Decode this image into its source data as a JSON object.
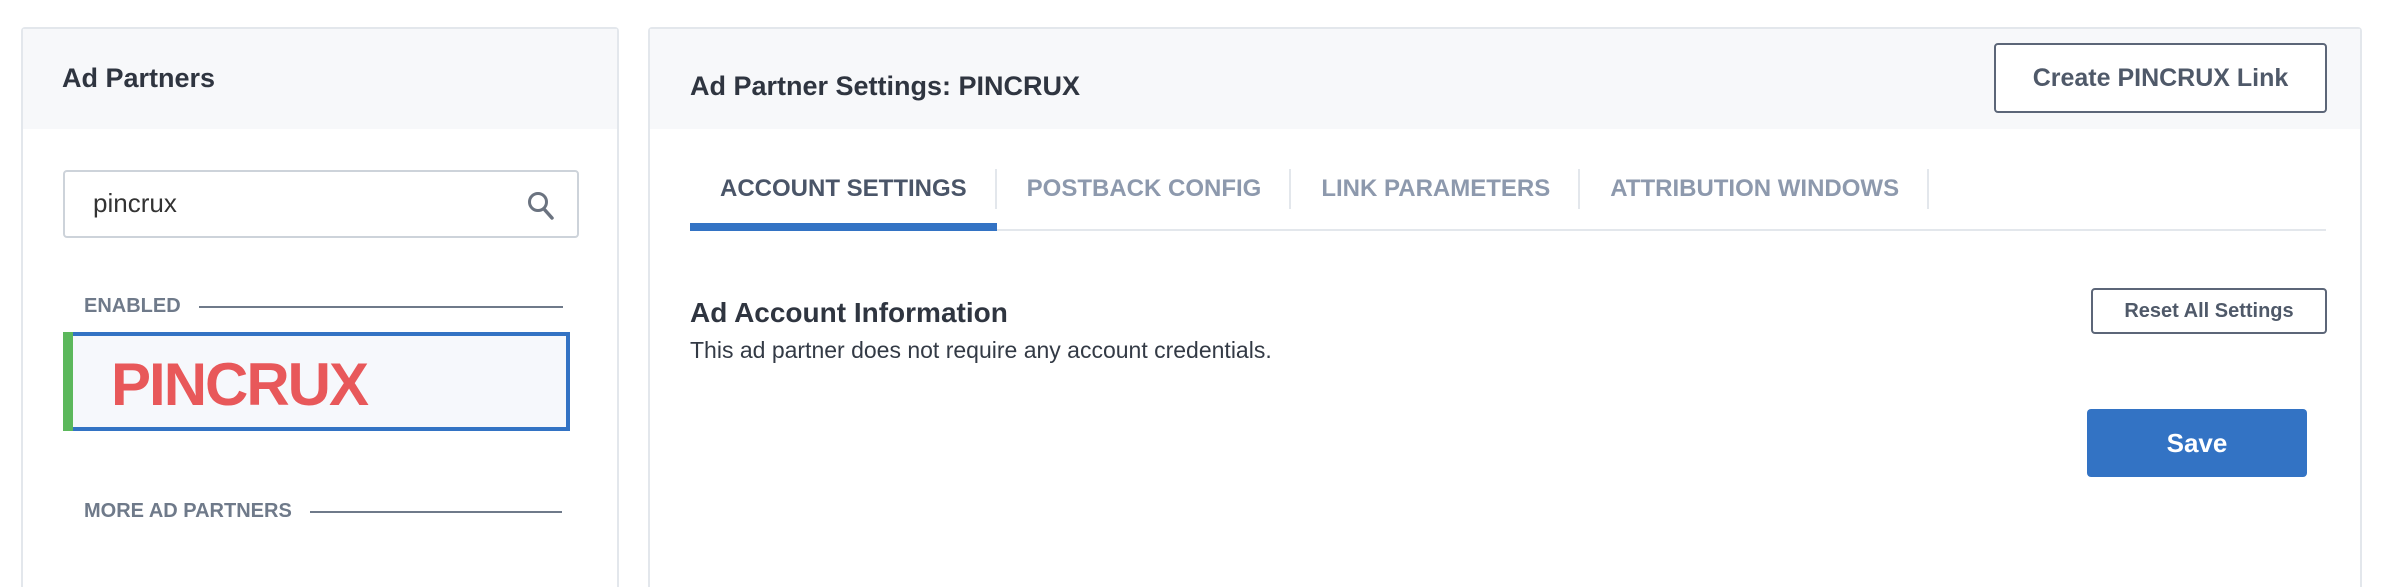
{
  "left_panel": {
    "title": "Ad Partners",
    "search": {
      "value": "pincrux",
      "icon": "search-icon"
    },
    "sections": {
      "enabled": "ENABLED",
      "more": "MORE AD PARTNERS"
    },
    "enabled_partners": [
      {
        "name": "PINCRUX",
        "status_color": "#5cb85c",
        "logo_color": "#e8585a"
      }
    ]
  },
  "right_panel": {
    "title": "Ad Partner Settings: PINCRUX",
    "create_link_label": "Create PINCRUX Link",
    "tabs": [
      {
        "label": "ACCOUNT SETTINGS",
        "active": true
      },
      {
        "label": "POSTBACK CONFIG",
        "active": false
      },
      {
        "label": "LINK PARAMETERS",
        "active": false
      },
      {
        "label": "ATTRIBUTION WINDOWS",
        "active": false
      }
    ],
    "section_title": "Ad Account Information",
    "section_text": "This ad partner does not require any account credentials.",
    "reset_label": "Reset All Settings",
    "save_label": "Save"
  },
  "colors": {
    "accent": "#3373c4",
    "enabled": "#5cb85c",
    "logo": "#e8585a"
  }
}
